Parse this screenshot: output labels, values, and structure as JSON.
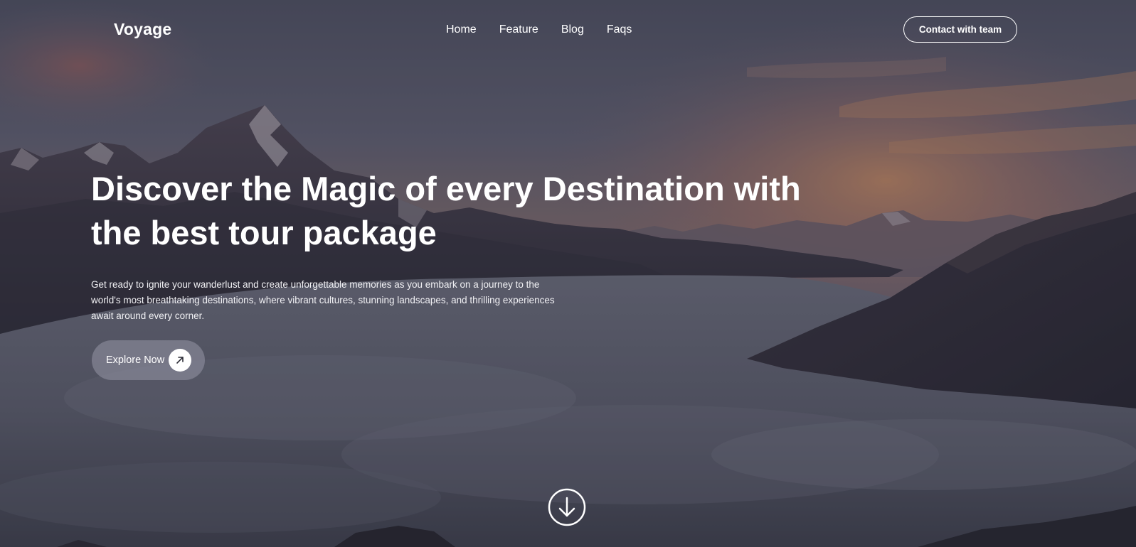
{
  "brand": {
    "name": "Voyage"
  },
  "nav": {
    "items": [
      {
        "label": "Home"
      },
      {
        "label": "Feature"
      },
      {
        "label": "Blog"
      },
      {
        "label": "Faqs"
      }
    ],
    "cta_label": "Contact with team"
  },
  "hero": {
    "title": "Discover the Magic of every Destination with the best tour package",
    "description": "Get ready to ignite your wanderlust and create unforgettable memories as you embark on a journey to the world's most breathtaking destinations, where vibrant cultures, stunning landscapes, and thrilling experiences await around every corner.",
    "button_label": "Explore Now",
    "button_icon": "arrow-up-right-icon",
    "scroll_icon": "arrow-down-circle-icon"
  },
  "colors": {
    "text": "#ffffff",
    "button_bg": "#8d8d9a",
    "sky_top": "#545666",
    "sky_glow": "#c97a55",
    "clouds": "#6c6f7e"
  }
}
